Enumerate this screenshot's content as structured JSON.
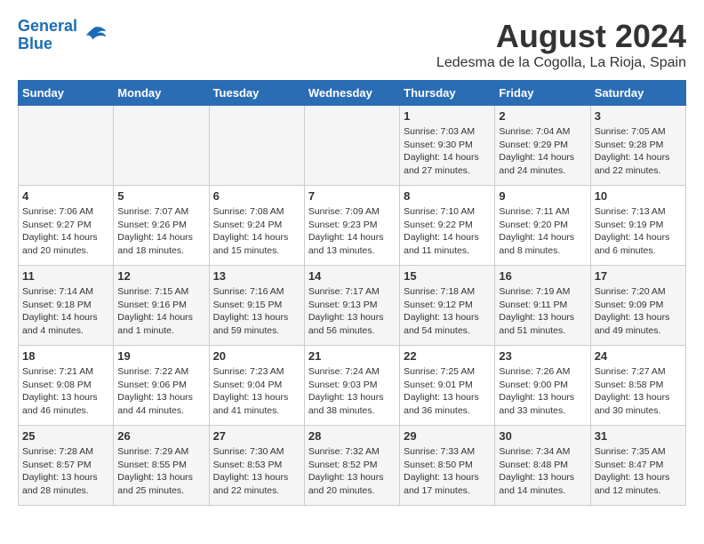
{
  "header": {
    "logo_line1": "General",
    "logo_line2": "Blue",
    "month_year": "August 2024",
    "location": "Ledesma de la Cogolla, La Rioja, Spain"
  },
  "days_of_week": [
    "Sunday",
    "Monday",
    "Tuesday",
    "Wednesday",
    "Thursday",
    "Friday",
    "Saturday"
  ],
  "weeks": [
    [
      {
        "day": "",
        "info": ""
      },
      {
        "day": "",
        "info": ""
      },
      {
        "day": "",
        "info": ""
      },
      {
        "day": "",
        "info": ""
      },
      {
        "day": "1",
        "info": "Sunrise: 7:03 AM\nSunset: 9:30 PM\nDaylight: 14 hours and 27 minutes."
      },
      {
        "day": "2",
        "info": "Sunrise: 7:04 AM\nSunset: 9:29 PM\nDaylight: 14 hours and 24 minutes."
      },
      {
        "day": "3",
        "info": "Sunrise: 7:05 AM\nSunset: 9:28 PM\nDaylight: 14 hours and 22 minutes."
      }
    ],
    [
      {
        "day": "4",
        "info": "Sunrise: 7:06 AM\nSunset: 9:27 PM\nDaylight: 14 hours and 20 minutes."
      },
      {
        "day": "5",
        "info": "Sunrise: 7:07 AM\nSunset: 9:26 PM\nDaylight: 14 hours and 18 minutes."
      },
      {
        "day": "6",
        "info": "Sunrise: 7:08 AM\nSunset: 9:24 PM\nDaylight: 14 hours and 15 minutes."
      },
      {
        "day": "7",
        "info": "Sunrise: 7:09 AM\nSunset: 9:23 PM\nDaylight: 14 hours and 13 minutes."
      },
      {
        "day": "8",
        "info": "Sunrise: 7:10 AM\nSunset: 9:22 PM\nDaylight: 14 hours and 11 minutes."
      },
      {
        "day": "9",
        "info": "Sunrise: 7:11 AM\nSunset: 9:20 PM\nDaylight: 14 hours and 8 minutes."
      },
      {
        "day": "10",
        "info": "Sunrise: 7:13 AM\nSunset: 9:19 PM\nDaylight: 14 hours and 6 minutes."
      }
    ],
    [
      {
        "day": "11",
        "info": "Sunrise: 7:14 AM\nSunset: 9:18 PM\nDaylight: 14 hours and 4 minutes."
      },
      {
        "day": "12",
        "info": "Sunrise: 7:15 AM\nSunset: 9:16 PM\nDaylight: 14 hours and 1 minute."
      },
      {
        "day": "13",
        "info": "Sunrise: 7:16 AM\nSunset: 9:15 PM\nDaylight: 13 hours and 59 minutes."
      },
      {
        "day": "14",
        "info": "Sunrise: 7:17 AM\nSunset: 9:13 PM\nDaylight: 13 hours and 56 minutes."
      },
      {
        "day": "15",
        "info": "Sunrise: 7:18 AM\nSunset: 9:12 PM\nDaylight: 13 hours and 54 minutes."
      },
      {
        "day": "16",
        "info": "Sunrise: 7:19 AM\nSunset: 9:11 PM\nDaylight: 13 hours and 51 minutes."
      },
      {
        "day": "17",
        "info": "Sunrise: 7:20 AM\nSunset: 9:09 PM\nDaylight: 13 hours and 49 minutes."
      }
    ],
    [
      {
        "day": "18",
        "info": "Sunrise: 7:21 AM\nSunset: 9:08 PM\nDaylight: 13 hours and 46 minutes."
      },
      {
        "day": "19",
        "info": "Sunrise: 7:22 AM\nSunset: 9:06 PM\nDaylight: 13 hours and 44 minutes."
      },
      {
        "day": "20",
        "info": "Sunrise: 7:23 AM\nSunset: 9:04 PM\nDaylight: 13 hours and 41 minutes."
      },
      {
        "day": "21",
        "info": "Sunrise: 7:24 AM\nSunset: 9:03 PM\nDaylight: 13 hours and 38 minutes."
      },
      {
        "day": "22",
        "info": "Sunrise: 7:25 AM\nSunset: 9:01 PM\nDaylight: 13 hours and 36 minutes."
      },
      {
        "day": "23",
        "info": "Sunrise: 7:26 AM\nSunset: 9:00 PM\nDaylight: 13 hours and 33 minutes."
      },
      {
        "day": "24",
        "info": "Sunrise: 7:27 AM\nSunset: 8:58 PM\nDaylight: 13 hours and 30 minutes."
      }
    ],
    [
      {
        "day": "25",
        "info": "Sunrise: 7:28 AM\nSunset: 8:57 PM\nDaylight: 13 hours and 28 minutes."
      },
      {
        "day": "26",
        "info": "Sunrise: 7:29 AM\nSunset: 8:55 PM\nDaylight: 13 hours and 25 minutes."
      },
      {
        "day": "27",
        "info": "Sunrise: 7:30 AM\nSunset: 8:53 PM\nDaylight: 13 hours and 22 minutes."
      },
      {
        "day": "28",
        "info": "Sunrise: 7:32 AM\nSunset: 8:52 PM\nDaylight: 13 hours and 20 minutes."
      },
      {
        "day": "29",
        "info": "Sunrise: 7:33 AM\nSunset: 8:50 PM\nDaylight: 13 hours and 17 minutes."
      },
      {
        "day": "30",
        "info": "Sunrise: 7:34 AM\nSunset: 8:48 PM\nDaylight: 13 hours and 14 minutes."
      },
      {
        "day": "31",
        "info": "Sunrise: 7:35 AM\nSunset: 8:47 PM\nDaylight: 13 hours and 12 minutes."
      }
    ]
  ]
}
